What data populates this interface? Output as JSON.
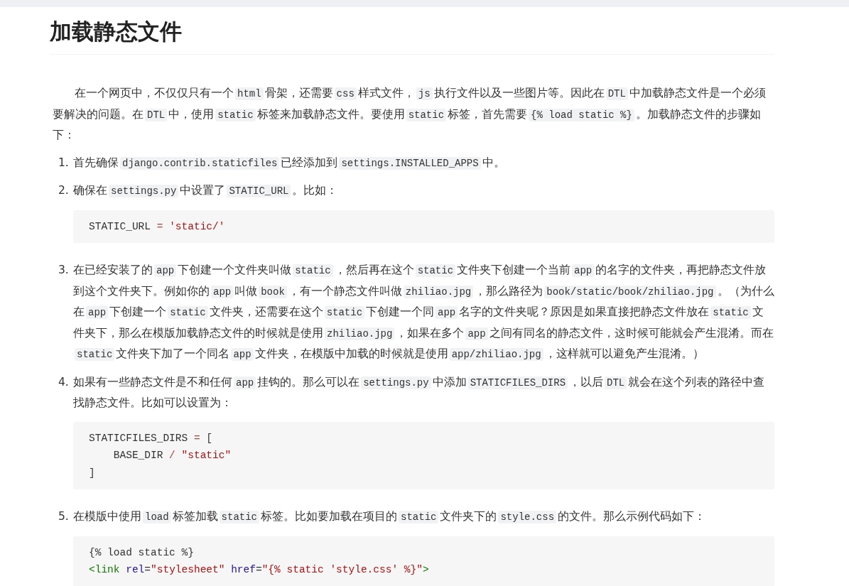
{
  "title": "加载静态文件",
  "intro": [
    {
      "text": "在一个网页中，不仅仅只有一个",
      "code": false
    },
    {
      "text": "html",
      "code": true
    },
    {
      "text": "骨架，还需要",
      "code": false
    },
    {
      "text": "css",
      "code": true
    },
    {
      "text": "样式文件，",
      "code": false
    },
    {
      "text": "js",
      "code": true
    },
    {
      "text": "执行文件以及一些图片等。因此在",
      "code": false
    },
    {
      "text": "DTL",
      "code": true
    },
    {
      "text": "中加载静态文件是一个必须要解决的问题。在",
      "code": false
    },
    {
      "text": "DTL",
      "code": true
    },
    {
      "text": "中，使用",
      "code": false
    },
    {
      "text": "static",
      "code": true
    },
    {
      "text": "标签来加载静态文件。要使用",
      "code": false
    },
    {
      "text": "static",
      "code": true
    },
    {
      "text": "标签，首先需要",
      "code": false
    },
    {
      "text": "{% load static %}",
      "code": true
    },
    {
      "text": "。加载静态文件的步骤如下：",
      "code": false
    }
  ],
  "steps": [
    {
      "number": "1.",
      "text": [
        {
          "text": "首先确保",
          "code": false
        },
        {
          "text": "django.contrib.staticfiles",
          "code": true
        },
        {
          "text": "已经添加到",
          "code": false
        },
        {
          "text": "settings.INSTALLED_APPS",
          "code": true
        },
        {
          "text": "中。",
          "code": false
        }
      ]
    },
    {
      "number": "2.",
      "text": [
        {
          "text": "确保在",
          "code": false
        },
        {
          "text": "settings.py",
          "code": true
        },
        {
          "text": "中设置了",
          "code": false
        },
        {
          "text": "STATIC_URL",
          "code": true
        },
        {
          "text": "。比如：",
          "code": false
        }
      ],
      "code_block": [
        [
          {
            "text": "STATIC_URL",
            "kind": "plain"
          },
          {
            "text": " = ",
            "kind": "operator"
          },
          {
            "text": "'static/'",
            "kind": "string"
          }
        ]
      ]
    },
    {
      "number": "3.",
      "text": [
        {
          "text": "在已经安装了的",
          "code": false
        },
        {
          "text": "app",
          "code": true
        },
        {
          "text": "下创建一个文件夹叫做",
          "code": false
        },
        {
          "text": "static",
          "code": true
        },
        {
          "text": "，然后再在这个",
          "code": false
        },
        {
          "text": "static",
          "code": true
        },
        {
          "text": "文件夹下创建一个当前",
          "code": false
        },
        {
          "text": "app",
          "code": true
        },
        {
          "text": "的名字的文件夹，再把静态文件放到这个文件夹下。例如你的",
          "code": false
        },
        {
          "text": "app",
          "code": true
        },
        {
          "text": "叫做",
          "code": false
        },
        {
          "text": "book",
          "code": true
        },
        {
          "text": "，有一个静态文件叫做",
          "code": false
        },
        {
          "text": "zhiliao.jpg",
          "code": true
        },
        {
          "text": "，那么路径为",
          "code": false
        },
        {
          "text": "book/static/book/zhiliao.jpg",
          "code": true
        },
        {
          "text": "。（为什么在",
          "code": false
        },
        {
          "text": "app",
          "code": true
        },
        {
          "text": "下创建一个",
          "code": false
        },
        {
          "text": "static",
          "code": true
        },
        {
          "text": "文件夹，还需要在这个",
          "code": false
        },
        {
          "text": "static",
          "code": true
        },
        {
          "text": "下创建一个同",
          "code": false
        },
        {
          "text": "app",
          "code": true
        },
        {
          "text": "名字的文件夹呢？原因是如果直接把静态文件放在",
          "code": false
        },
        {
          "text": "static",
          "code": true
        },
        {
          "text": "文件夹下，那么在模版加载静态文件的时候就是使用",
          "code": false
        },
        {
          "text": "zhiliao.jpg",
          "code": true
        },
        {
          "text": "，如果在多个",
          "code": false
        },
        {
          "text": "app",
          "code": true
        },
        {
          "text": "之间有同名的静态文件，这时候可能就会产生混淆。而在",
          "code": false
        },
        {
          "text": "static",
          "code": true
        },
        {
          "text": "文件夹下加了一个同名",
          "code": false
        },
        {
          "text": "app",
          "code": true
        },
        {
          "text": "文件夹，在模版中加载的时候就是使用",
          "code": false
        },
        {
          "text": "app/zhiliao.jpg",
          "code": true
        },
        {
          "text": "，这样就可以避免产生混淆。）",
          "code": false
        }
      ]
    },
    {
      "number": "4.",
      "text": [
        {
          "text": "如果有一些静态文件是不和任何",
          "code": false
        },
        {
          "text": "app",
          "code": true
        },
        {
          "text": "挂钩的。那么可以在",
          "code": false
        },
        {
          "text": "settings.py",
          "code": true
        },
        {
          "text": "中添加",
          "code": false
        },
        {
          "text": "STATICFILES_DIRS",
          "code": true
        },
        {
          "text": "，以后",
          "code": false
        },
        {
          "text": "DTL",
          "code": true
        },
        {
          "text": "就会在这个列表的路径中查找静态文件。比如可以设置为：",
          "code": false
        }
      ],
      "code_block": [
        [
          {
            "text": "STATICFILES_DIRS",
            "kind": "plain"
          },
          {
            "text": " = ",
            "kind": "operator"
          },
          {
            "text": "[",
            "kind": "plain"
          }
        ],
        [
          {
            "text": "    BASE_DIR",
            "kind": "plain"
          },
          {
            "text": " / ",
            "kind": "operator"
          },
          {
            "text": "\"static\"",
            "kind": "string"
          }
        ],
        [
          {
            "text": "]",
            "kind": "plain"
          }
        ]
      ]
    },
    {
      "number": "5.",
      "text": [
        {
          "text": "在模版中使用",
          "code": false
        },
        {
          "text": "load",
          "code": true
        },
        {
          "text": "标签加载",
          "code": false
        },
        {
          "text": "static",
          "code": true
        },
        {
          "text": "标签。比如要加载在项目的",
          "code": false
        },
        {
          "text": "static",
          "code": true
        },
        {
          "text": "文件夹下的",
          "code": false
        },
        {
          "text": "style.css",
          "code": true
        },
        {
          "text": "的文件。那么示例代码如下：",
          "code": false
        }
      ],
      "code_block": [
        [
          {
            "text": "{% load static %}",
            "kind": "plain"
          }
        ],
        [
          {
            "text": "<link",
            "kind": "tag"
          },
          {
            "text": " rel",
            "kind": "attribute"
          },
          {
            "text": "=",
            "kind": "plain"
          },
          {
            "text": "\"stylesheet\"",
            "kind": "string"
          },
          {
            "text": " href",
            "kind": "attribute"
          },
          {
            "text": "=",
            "kind": "plain"
          },
          {
            "text": "\"{% static 'style.css' %}\"",
            "kind": "string"
          },
          {
            "text": ">",
            "kind": "tag"
          }
        ]
      ]
    }
  ]
}
